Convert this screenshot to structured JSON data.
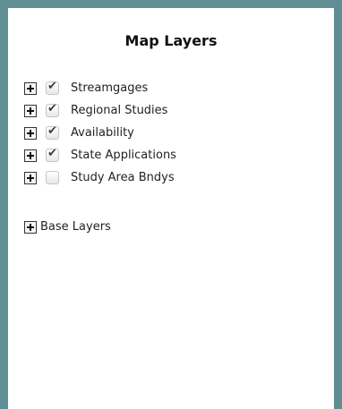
{
  "panel": {
    "title": "Map Layers",
    "border_color": "#5f8f94"
  },
  "layers": [
    {
      "label": "Streamgages",
      "checked": true
    },
    {
      "label": "Regional Studies",
      "checked": true
    },
    {
      "label": "Availability",
      "checked": true
    },
    {
      "label": "State Applications",
      "checked": true
    },
    {
      "label": "Study Area Bndys",
      "checked": false
    }
  ],
  "base_layers": {
    "label": "Base Layers"
  },
  "icons": {
    "expand": "plus-icon",
    "check": "checkmark-icon"
  }
}
